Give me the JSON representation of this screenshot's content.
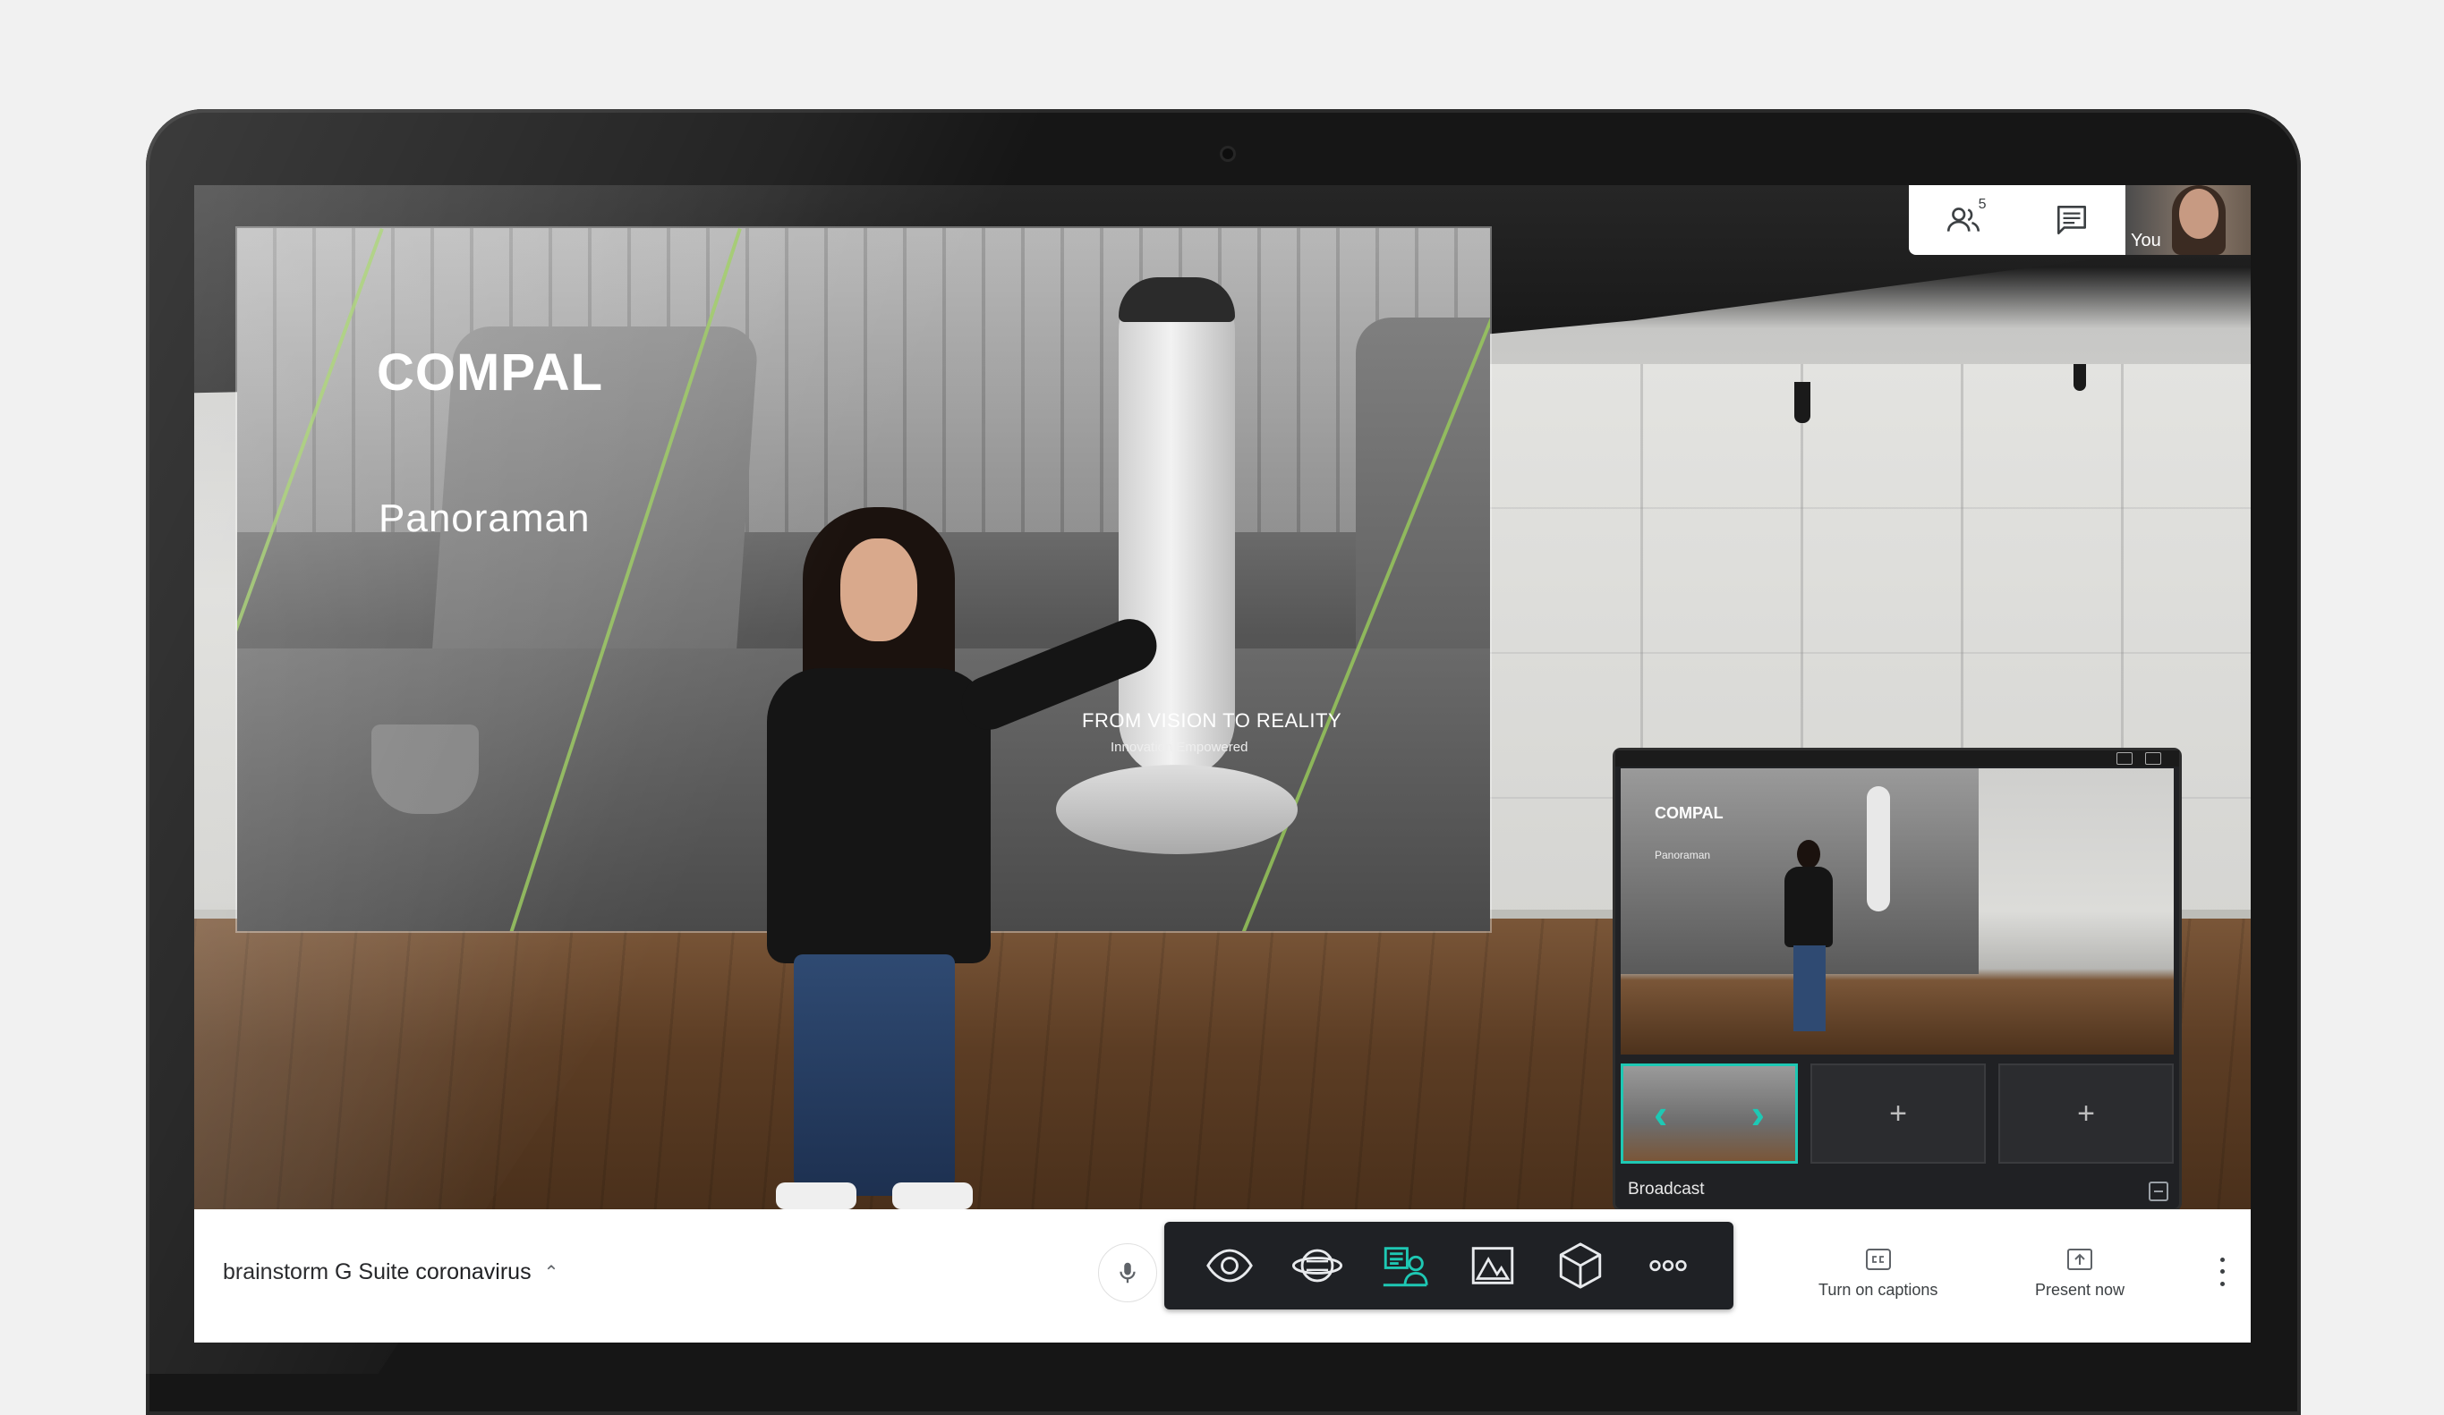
{
  "slide": {
    "brand": "COMPAL",
    "subtitle": "Panoraman",
    "tagline": "FROM VISION TO REALITY",
    "tagline_sub": "Innovation Empowered"
  },
  "top_panel": {
    "participants_count": "5",
    "participants_icon": "people-icon",
    "chat_icon": "chat-icon",
    "self_label": "You"
  },
  "broadcast": {
    "preview_brand": "COMPAL",
    "preview_subtitle": "Panoraman",
    "thumb_add": "+",
    "label": "Broadcast"
  },
  "bottom_bar": {
    "meeting_title": "brainstorm G Suite coronavirus",
    "expand_icon": "chevron-up-icon",
    "mic_icon": "microphone-icon",
    "tools": [
      "eye-icon",
      "360-view-icon",
      "presenter-overlay-icon",
      "image-icon",
      "3d-cube-icon",
      "more-options-icon"
    ],
    "captions_label": "Turn on captions",
    "present_label": "Present now"
  },
  "colors": {
    "accent_teal": "#1ec8b4",
    "dock_background": "#1f2125",
    "bar_background": "#ffffff"
  }
}
